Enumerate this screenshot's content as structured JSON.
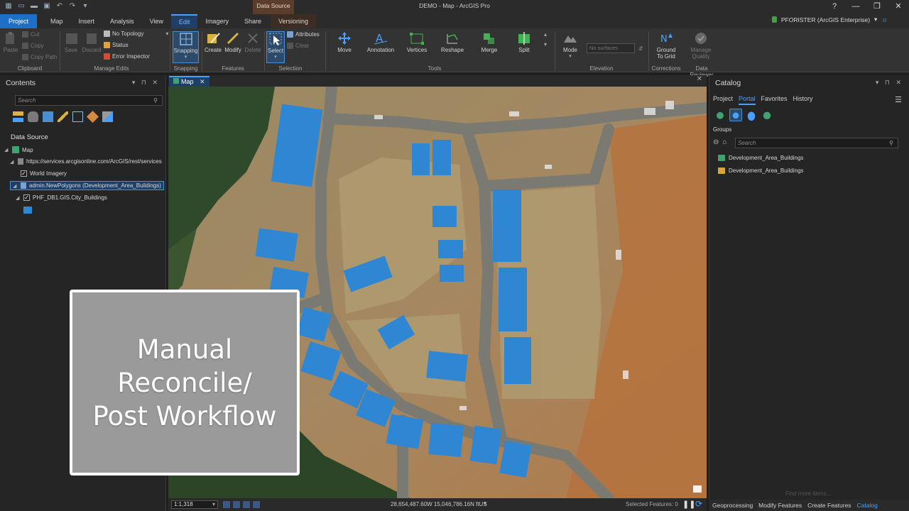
{
  "title_bar": {
    "app_title": "DEMO - Map - ArcGIS Pro",
    "contextual_group": "Data Source",
    "help": "?",
    "minimize": "—",
    "restore": "❐",
    "close": "✕"
  },
  "ribbon_tabs": [
    "Project",
    "Map",
    "Insert",
    "Analysis",
    "View",
    "Edit",
    "Imagery",
    "Share",
    "Versioning"
  ],
  "user": {
    "name": "PFORISTER (ArcGIS Enterprise)",
    "caret": "▾"
  },
  "ribbon": {
    "clipboard": {
      "paste": "Paste",
      "cut": "Cut",
      "copy": "Copy",
      "copy_path": "Copy Path",
      "label": "Clipboard"
    },
    "manage_edits": {
      "save": "Save",
      "discard": "Discard",
      "topology": "No Topology",
      "status": "Status",
      "error_inspector": "Error Inspector",
      "label": "Manage Edits"
    },
    "snapping": {
      "button": "Snapping",
      "label": "Snapping"
    },
    "features": {
      "create": "Create",
      "modify": "Modify",
      "delete": "Delete",
      "label": "Features"
    },
    "selection": {
      "select": "Select",
      "attributes": "Attributes",
      "clear": "Clear",
      "label": "Selection"
    },
    "tools": {
      "move": "Move",
      "annotation": "Annotation",
      "vertices": "Vertices",
      "reshape": "Reshape",
      "merge": "Merge",
      "split": "Split",
      "label": "Tools"
    },
    "elevation": {
      "mode": "Mode",
      "surface_placeholder": "No surfaces",
      "label": "Elevation"
    },
    "corrections": {
      "ground_to_grid_1": "Ground",
      "ground_to_grid_2": "To Grid",
      "label": "Corrections"
    },
    "data_reviewer": {
      "manage_quality_1": "Manage",
      "manage_quality_2": "Quality",
      "label": "Data Reviewer"
    }
  },
  "contents": {
    "title": "Contents",
    "search_placeholder": "Search",
    "section": "Data Source",
    "tree": {
      "map": "Map",
      "service_url": "https://services.arcgisonline.com/ArcGIS/rest/services",
      "world_imagery": "World Imagery",
      "connection": "admin.NewPolygons (Development_Area_Buildings)",
      "layer": "PHF_DB1.GIS.City_Buildings"
    }
  },
  "map_view": {
    "tab_label": "Map",
    "scale": "1:1,318",
    "coordinates": "28,654,487.60W 15,046,786.16N ftUS",
    "selected_features": "Selected Features: 0",
    "building_color": "#2f86d2"
  },
  "overlay": {
    "line1": "Manual",
    "line2": "Reconcile/",
    "line3": "Post Workflow"
  },
  "catalog": {
    "title": "Catalog",
    "tabs": [
      "Project",
      "Portal",
      "Favorites",
      "History"
    ],
    "active_tab": "Portal",
    "groups_label": "Groups",
    "search_placeholder": "Search",
    "items": [
      "Development_Area_Buildings",
      "Development_Area_Buildings"
    ],
    "find_more": "Find more items..."
  },
  "bottom_tabs": [
    "Geoprocessing",
    "Modify Features",
    "Create Features",
    "Catalog"
  ]
}
